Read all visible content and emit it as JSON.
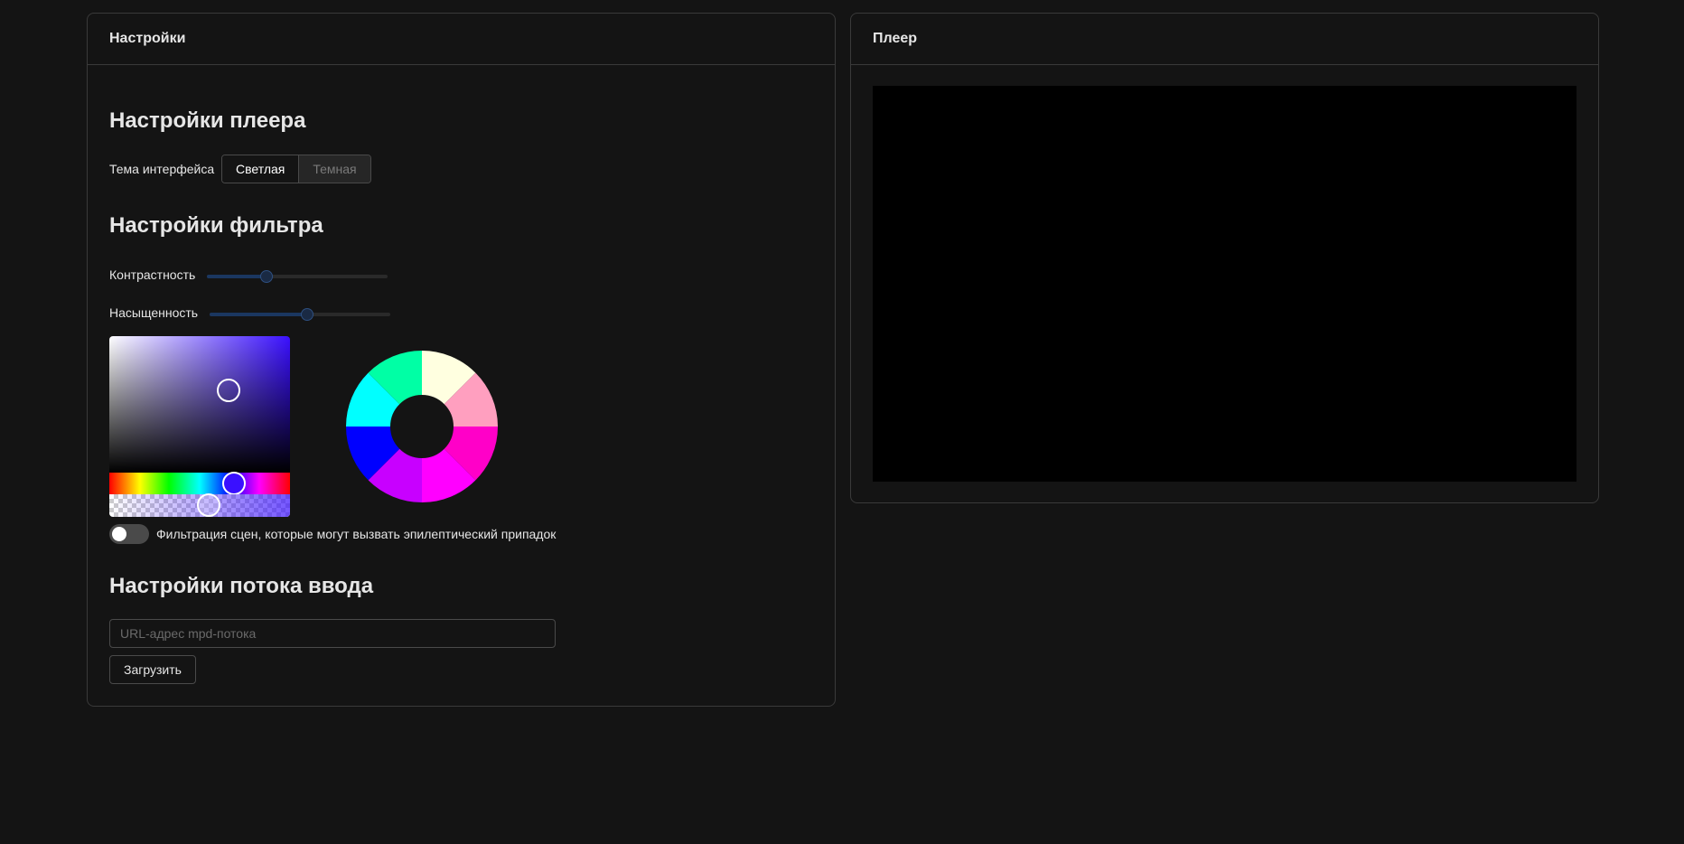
{
  "settings_panel": {
    "title": "Настройки",
    "player_section": {
      "title": "Настройки плеера",
      "theme_label": "Тема интерфейса",
      "theme_options": [
        "Светлая",
        "Темная"
      ],
      "theme_selected": "Светлая"
    },
    "filter_section": {
      "title": "Настройки фильтра",
      "contrast_label": "Контрастность",
      "contrast_value": 0.33,
      "saturation_label": "Насыщенность",
      "saturation_value": 0.54,
      "color_picker": {
        "color": "#3a10ff",
        "saturation": 0.66,
        "value": 0.6,
        "hue_position": 0.69,
        "alpha": 0.55
      },
      "color_wheel": {
        "segments": [
          "#ffffe0",
          "#ff9fbf",
          "#ff00c8",
          "#ff00ff",
          "#c800ff",
          "#0000ff",
          "#00ffff",
          "#00ffa5"
        ]
      },
      "epilepsy_toggle_label": "Фильтрация сцен, которые могут вызвать эпилептический припадок",
      "epilepsy_toggle_on": false
    },
    "stream_section": {
      "title": "Настройки потока ввода",
      "url_placeholder": "URL-адрес mpd-потока",
      "url_value": "",
      "load_button": "Загрузить"
    }
  },
  "player_panel": {
    "title": "Плеер"
  }
}
